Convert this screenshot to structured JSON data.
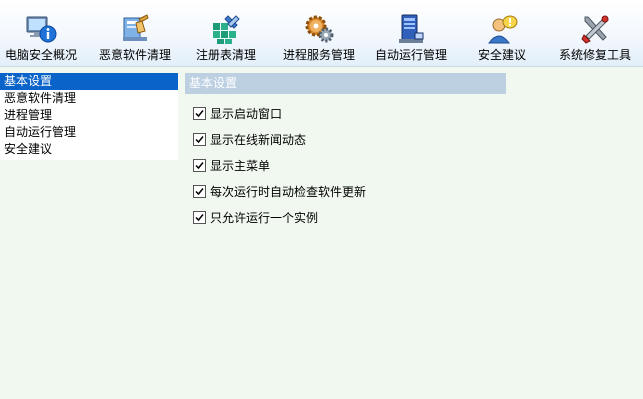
{
  "toolbar": {
    "items": [
      {
        "label": "电脑安全概况",
        "icon": "computer-info-icon"
      },
      {
        "label": "恶意软件清理",
        "icon": "malware-cleanup-icon"
      },
      {
        "label": "注册表清理",
        "icon": "registry-cleanup-icon"
      },
      {
        "label": "进程服务管理",
        "icon": "process-gear-icon"
      },
      {
        "label": "自动运行管理",
        "icon": "startup-program-icon"
      },
      {
        "label": "安全建议",
        "icon": "security-advice-user-icon"
      },
      {
        "label": "系统修复工具",
        "icon": "repair-tools-icon"
      }
    ]
  },
  "sidebar": {
    "items": [
      {
        "label": "基本设置",
        "selected": true
      },
      {
        "label": "恶意软件清理",
        "selected": false
      },
      {
        "label": "进程管理",
        "selected": false
      },
      {
        "label": "自动运行管理",
        "selected": false
      },
      {
        "label": "安全建议",
        "selected": false
      }
    ]
  },
  "panel": {
    "title": "基本设置",
    "options": [
      {
        "label": "显示启动窗口",
        "checked": true
      },
      {
        "label": "显示在线新闻动态",
        "checked": true
      },
      {
        "label": "显示主菜单",
        "checked": true
      },
      {
        "label": "每次运行时自动检查软件更新",
        "checked": true
      },
      {
        "label": "只允许运行一个实例",
        "checked": true
      }
    ]
  },
  "colors": {
    "selection": "#0a63c9",
    "section_header": "#bcd0e2",
    "background": "#f1f8f0"
  }
}
